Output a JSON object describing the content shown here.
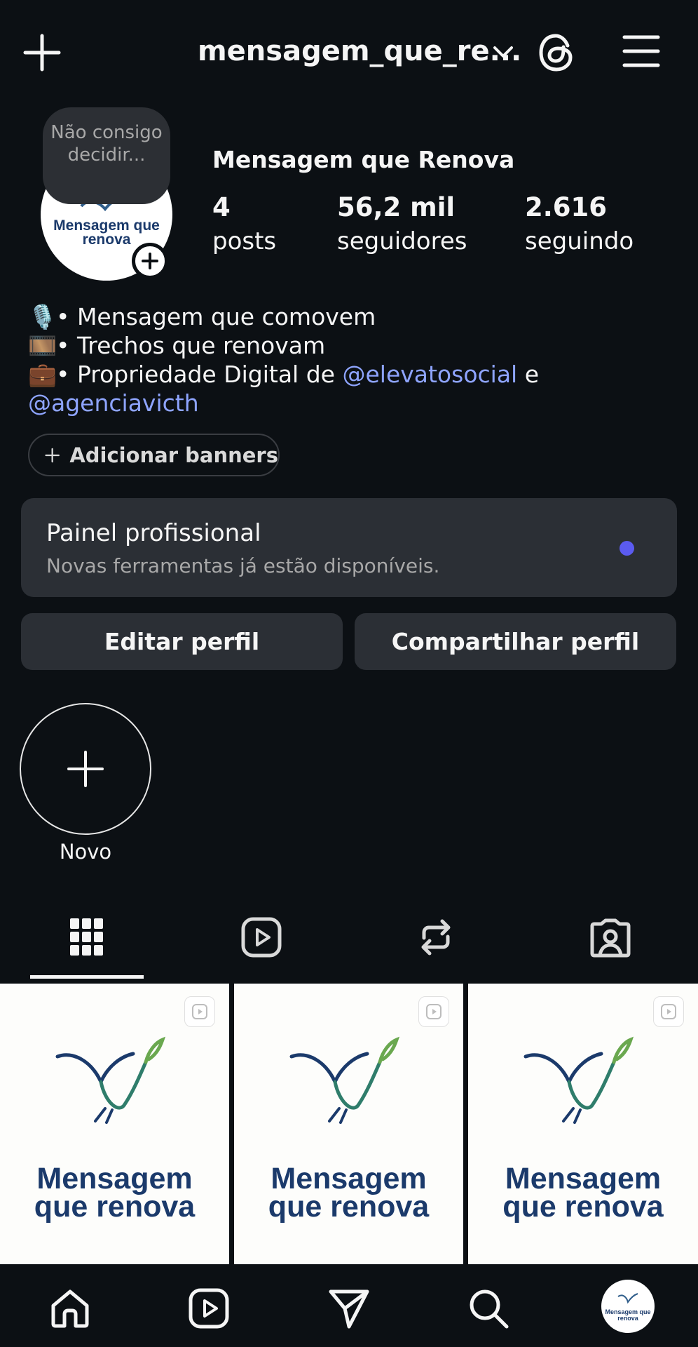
{
  "header": {
    "username": "mensagem_que_re..."
  },
  "profile": {
    "note": "Não consigo decidir...",
    "avatar_logo_text": "Mensagem que renova",
    "display_name": "Mensagem que Renova",
    "stats": [
      {
        "value": "4",
        "label": "posts"
      },
      {
        "value": "56,2 mil",
        "label": "seguidores"
      },
      {
        "value": "2.616",
        "label": "seguindo"
      }
    ],
    "bio": {
      "line1": "• Mensagem que comovem",
      "line2": "• Trechos que renovam",
      "line3_prefix": "• Propriedade Digital de ",
      "line3_link": "@elevatosocial",
      "line3_suffix": " e",
      "line4_link": "@agenciavicth",
      "emojis": [
        "🎙️",
        "🎞️",
        "💼"
      ]
    }
  },
  "banner_button": "Adicionar banners",
  "pro_panel": {
    "title": "Painel profissional",
    "subtitle": "Novas ferramentas já estão disponíveis.",
    "dot_color": "#5b5bf0"
  },
  "actions": {
    "edit": "Editar perfil",
    "share": "Compartilhar perfil"
  },
  "highlights": {
    "new_label": "Novo"
  },
  "tabs": [
    "grid-icon",
    "reels-icon",
    "reposts-icon",
    "tagged-icon"
  ],
  "posts": [
    {
      "logo_line1": "Mensagem",
      "logo_line2": "que renova"
    },
    {
      "logo_line1": "Mensagem",
      "logo_line2": "que renova"
    },
    {
      "logo_line1": "Mensagem",
      "logo_line2": "que renova"
    }
  ],
  "bottom_nav": [
    "home-icon",
    "reels-icon",
    "direct-icon",
    "search-icon",
    "profile-avatar"
  ],
  "colors": {
    "background": "#0c1014",
    "card": "#2b2f35",
    "link": "#8ea4ff",
    "logo_blue": "#1b3a6b",
    "logo_green": "#6aa84f"
  }
}
